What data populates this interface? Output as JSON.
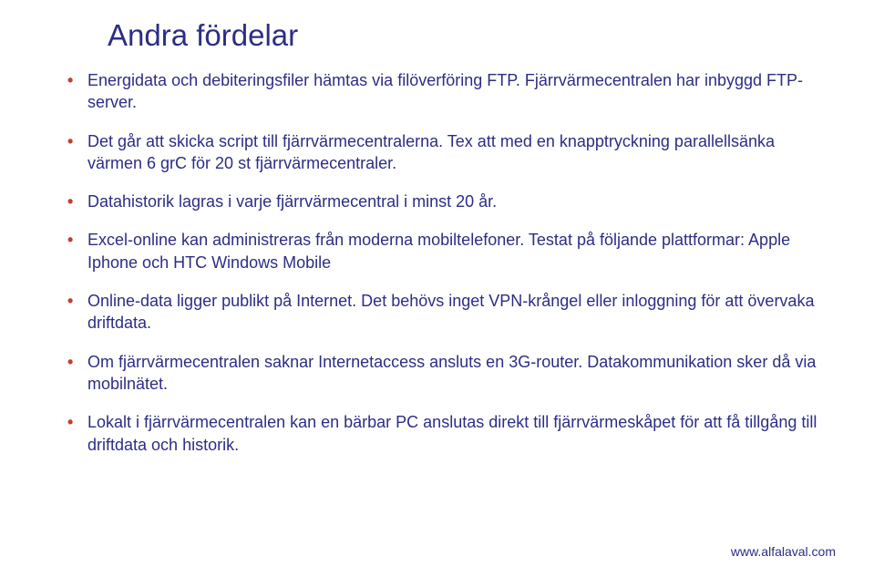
{
  "title": "Andra fördelar",
  "bullets": [
    "Energidata och debiteringsfiler hämtas via filöverföring FTP. Fjärrvärmecentralen har inbyggd FTP-server.",
    "Det går att skicka script till fjärrvärmecentralerna. Tex att med en knapptryckning parallellsänka värmen 6 grC för 20 st fjärrvärmecentraler.",
    "Datahistorik lagras i varje fjärrvärmecentral i minst 20 år.",
    "Excel-online kan administreras från moderna mobiltelefoner. Testat på följande plattformar: Apple Iphone och HTC Windows Mobile",
    "Online-data ligger publikt på Internet. Det behövs inget VPN-krångel eller inloggning för att övervaka driftdata.",
    "Om fjärrvärmecentralen saknar Internetaccess ansluts en 3G-router. Datakommunikation sker då via mobilnätet.",
    "Lokalt i fjärrvärmecentralen kan en bärbar PC anslutas direkt till fjärrvärmeskåpet för att få tillgång till driftdata och historik."
  ],
  "footer": {
    "prefix": "www.",
    "domain": "alfalaval.com"
  }
}
